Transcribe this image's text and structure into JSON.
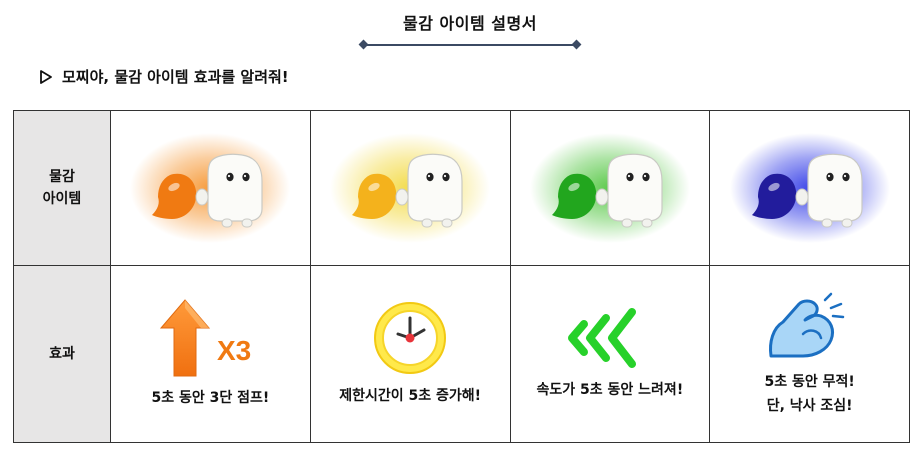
{
  "header": {
    "title": "물감 아이템 설명서"
  },
  "intro": {
    "text": "모찌야, 물감 아이템 효과를 알려줘!",
    "bullet_icon": "triangle-right-icon"
  },
  "table": {
    "row_headers": {
      "items_line1": "물감",
      "items_line2": "아이템",
      "effect": "효과"
    },
    "items": [
      {
        "color_name": "orange",
        "blob": "#f07a12",
        "glow": "#f5922a",
        "icon": "orange-paint-blob-with-mochi"
      },
      {
        "color_name": "yellow",
        "blob": "#f4b21c",
        "glow": "#f2d83a",
        "icon": "yellow-paint-blob-with-mochi"
      },
      {
        "color_name": "green",
        "blob": "#22a61e",
        "glow": "#4cc43a",
        "icon": "green-paint-blob-with-mochi"
      },
      {
        "color_name": "blue",
        "blob": "#221c9c",
        "glow": "#2b35e6",
        "icon": "blue-paint-blob-with-mochi"
      }
    ],
    "effects": [
      {
        "icon": "jump-arrow-icon",
        "badge": "X3",
        "line1": "5초 동안 3단 점프!",
        "line2": ""
      },
      {
        "icon": "clock-icon",
        "badge": "",
        "line1": "제한시간이 5초 증가해!",
        "line2": ""
      },
      {
        "icon": "slow-chevrons-icon",
        "badge": "",
        "line1": "속도가 5초 동안 느려져!",
        "line2": ""
      },
      {
        "icon": "flexed-arm-icon",
        "badge": "",
        "line1": "5초 동안 무적!",
        "line2": "단, 낙사 조심!"
      }
    ]
  }
}
